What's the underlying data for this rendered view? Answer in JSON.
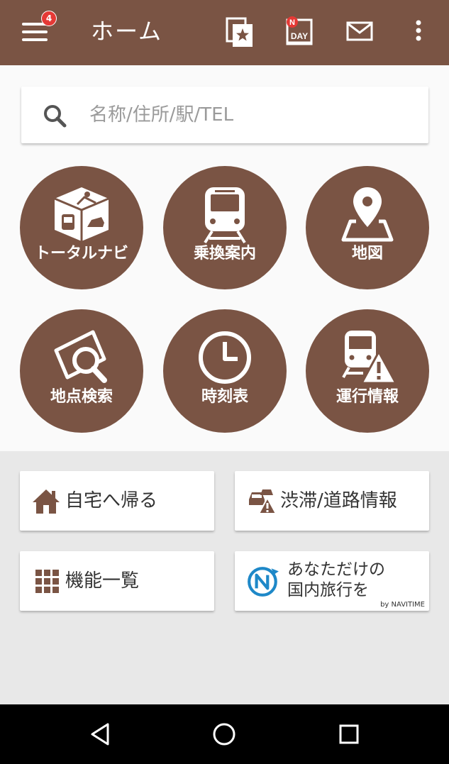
{
  "appbar": {
    "title": "ホーム",
    "menu_badge": "4",
    "favorites_icon": "favorite-star-icon",
    "nday_label": "DAY",
    "nday_letter": "N"
  },
  "search": {
    "placeholder": "名称/住所/駅/TEL"
  },
  "grid": {
    "items": [
      {
        "label": "トータルナビ",
        "icon": "total-navi-icon"
      },
      {
        "label": "乗換案内",
        "icon": "train-icon"
      },
      {
        "label": "地図",
        "icon": "map-pin-icon"
      },
      {
        "label": "地点検索",
        "icon": "map-search-icon"
      },
      {
        "label": "時刻表",
        "icon": "clock-icon"
      },
      {
        "label": "運行情報",
        "icon": "train-alert-icon"
      }
    ]
  },
  "cards": {
    "home": {
      "label": "自宅へ帰る"
    },
    "traffic": {
      "label": "渋滞/道路情報"
    },
    "features": {
      "label": "機能一覧"
    },
    "travel": {
      "line1": "あなただけの",
      "line2": "国内旅行を",
      "by": "by NAVITIME"
    }
  },
  "colors": {
    "brand": "#7a5444",
    "badge": "#e53935"
  }
}
